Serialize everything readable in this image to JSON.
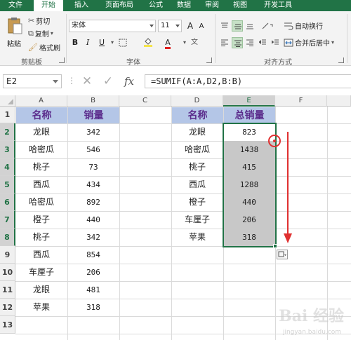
{
  "tabs": [
    "文件",
    "开始",
    "插入",
    "页面布局",
    "公式",
    "数据",
    "审阅",
    "视图",
    "开发工具"
  ],
  "active_tab": "开始",
  "ribbon": {
    "clipboard": {
      "paste": "粘贴",
      "cut": "剪切",
      "copy": "复制",
      "copy_arrow": "▾",
      "format_painter": "格式刷",
      "label": "剪贴板"
    },
    "font": {
      "name": "宋体",
      "size": "11",
      "grow": "A",
      "shrink": "A",
      "bold": "B",
      "italic": "I",
      "underline": "U",
      "label": "字体"
    },
    "alignment": {
      "wrap": "自动换行",
      "merge": "合并后居中",
      "label": "对齐方式"
    }
  },
  "formula_bar": {
    "name_box": "E2",
    "cancel": "✕",
    "enter": "✓",
    "fx": "fx",
    "formula": "=SUMIF(A:A,D2,B:B)"
  },
  "columns": [
    "A",
    "B",
    "C",
    "D",
    "E",
    "F"
  ],
  "rows": [
    "1",
    "2",
    "3",
    "4",
    "5",
    "6",
    "7",
    "8",
    "9",
    "10",
    "11",
    "12",
    "13"
  ],
  "sheet": {
    "table1_headers": [
      "名称",
      "销量"
    ],
    "table1": [
      [
        "龙眼",
        "342"
      ],
      [
        "哈密瓜",
        "546"
      ],
      [
        "桃子",
        "73"
      ],
      [
        "西瓜",
        "434"
      ],
      [
        "哈密瓜",
        "892"
      ],
      [
        "橙子",
        "440"
      ],
      [
        "桃子",
        "342"
      ],
      [
        "西瓜",
        "854"
      ],
      [
        "车厘子",
        "206"
      ],
      [
        "龙眼",
        "481"
      ],
      [
        "苹果",
        "318"
      ]
    ],
    "table2_headers": [
      "名称",
      "总销量"
    ],
    "table2": [
      [
        "龙眼",
        "823"
      ],
      [
        "哈密瓜",
        "1438"
      ],
      [
        "桃子",
        "415"
      ],
      [
        "西瓜",
        "1288"
      ],
      [
        "橙子",
        "440"
      ],
      [
        "车厘子",
        "206"
      ],
      [
        "苹果",
        "318"
      ]
    ]
  },
  "colors": {
    "excel_green": "#217346",
    "header_fill": "#b4c6e7",
    "header_text": "#5b2c8c",
    "annotation_red": "#e03030"
  },
  "watermark": {
    "text": "Bai 经验",
    "sub": "jingyan.baidu.com"
  }
}
